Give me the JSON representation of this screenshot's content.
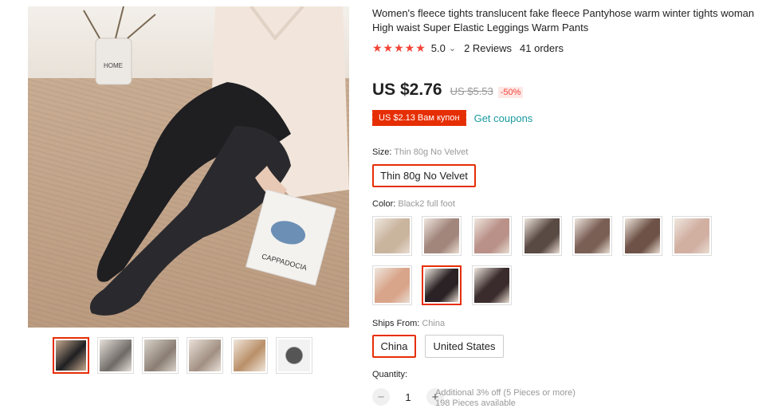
{
  "product": {
    "title": "Women's fleece tights translucent fake fleece Pantyhose warm winter tights woman High waist Super Elastic Leggings Warm Pants",
    "rating_score": "5.0",
    "rating_chevron": "⌄",
    "reviews": "2 Reviews",
    "orders": "41 orders",
    "price": "US $2.76",
    "old_price": "US $5.53",
    "discount": "-50%",
    "coupon": "US $2.13 Вам купон",
    "get_coupons": "Get coupons"
  },
  "size": {
    "label": "Size: ",
    "value": "Thin 80g No Velvet",
    "option": "Thin 80g No Velvet"
  },
  "color": {
    "label": "Color: ",
    "value": "Black2 full foot",
    "swatches": [
      "#c9b49e",
      "#a2867c",
      "#b99189",
      "#5a4a44",
      "#7a5f55",
      "#6e5247",
      "#d1b0a2",
      "#d9a58a",
      "#2a2224",
      "#3a2c2c"
    ]
  },
  "ships": {
    "label": "Ships From: ",
    "value": "China",
    "options": [
      "China",
      "United States"
    ]
  },
  "quantity": {
    "label": "Quantity:",
    "minus": "−",
    "plus": "+",
    "value": "1",
    "info1": "Additional 3% off (5 Pieces or more)",
    "info2": "198 Pieces available"
  },
  "main_image": {
    "book_text": "CAPPADOCIA",
    "vase_text": "HOME"
  },
  "colors": {
    "accent": "#e62e04",
    "link": "#1a9aa0",
    "star": "#f44336"
  }
}
